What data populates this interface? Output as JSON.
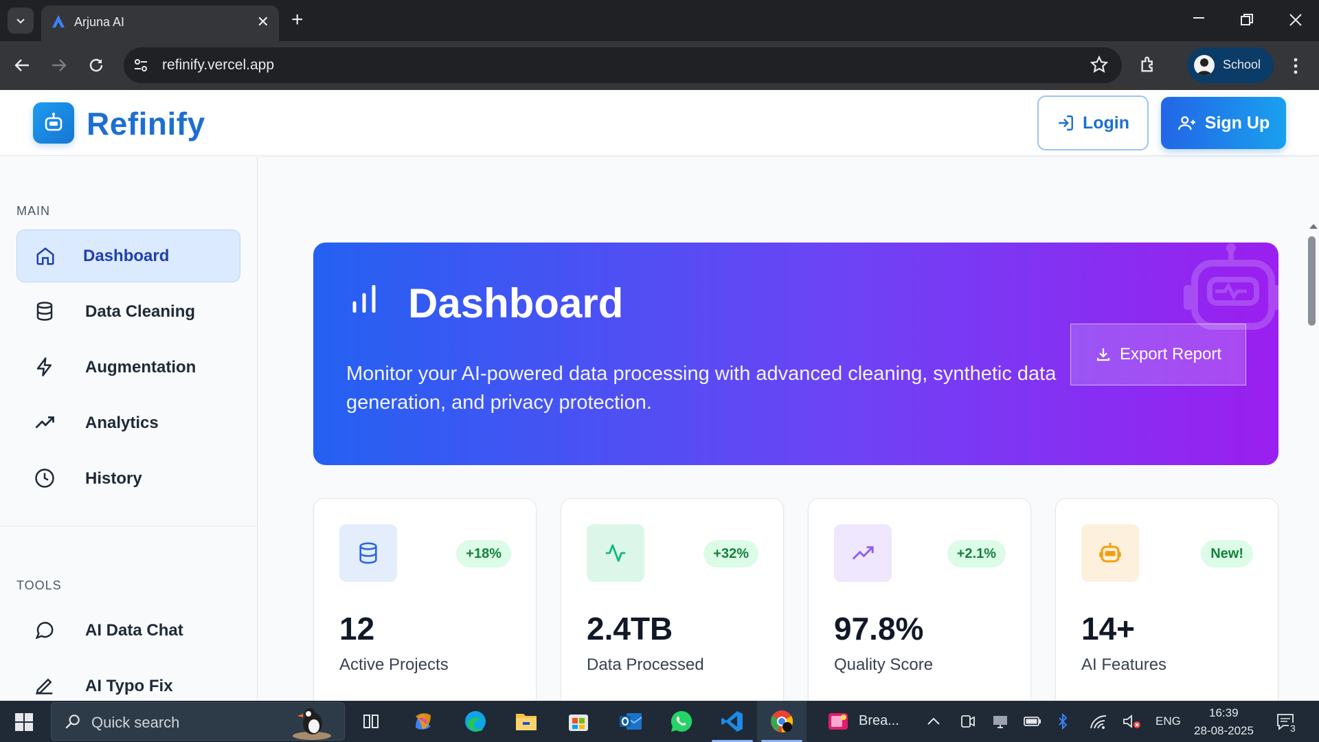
{
  "browser": {
    "tab_title": "Arjuna AI",
    "tab_close": "✕",
    "new_tab": "+",
    "url": "refinify.vercel.app",
    "profile_label": "School"
  },
  "app": {
    "brand": "Refinify",
    "login_label": "Login",
    "signup_label": "Sign Up"
  },
  "sidebar": {
    "main_title": "MAIN",
    "tools_title": "TOOLS",
    "main_items": [
      {
        "label": "Dashboard",
        "icon": "home-icon",
        "active": true
      },
      {
        "label": "Data Cleaning",
        "icon": "database-icon"
      },
      {
        "label": "Augmentation",
        "icon": "lightning-icon"
      },
      {
        "label": "Analytics",
        "icon": "trending-up-icon"
      },
      {
        "label": "History",
        "icon": "clock-icon"
      }
    ],
    "tool_items": [
      {
        "label": "AI Data Chat",
        "icon": "chat-bubble-icon"
      },
      {
        "label": "AI Typo Fix",
        "icon": "pen-icon"
      }
    ]
  },
  "hero": {
    "title": "Dashboard",
    "description": "Monitor your AI-powered data processing with advanced cleaning, synthetic data generation, and privacy protection.",
    "export_label": "Export Report"
  },
  "stats": [
    {
      "value": "12",
      "label": "Active Projects",
      "badge": "+18%",
      "icon": "database-icon",
      "icon_bg": "#e4edfc",
      "icon_color": "#2563eb"
    },
    {
      "value": "2.4TB",
      "label": "Data Processed",
      "badge": "+32%",
      "icon": "activity-icon",
      "icon_bg": "#dcf7ea",
      "icon_color": "#10b981"
    },
    {
      "value": "97.8%",
      "label": "Quality Score",
      "badge": "+2.1%",
      "icon": "trending-up-icon",
      "icon_bg": "#efe7fd",
      "icon_color": "#8b5cf6"
    },
    {
      "value": "14+",
      "label": "AI Features",
      "badge": "New!",
      "icon": "robot-icon",
      "icon_bg": "#fdf1de",
      "icon_color": "#f59e0b"
    }
  ],
  "taskbar": {
    "search_placeholder": "Quick search",
    "running_app_label": "Brea...",
    "language": "ENG",
    "time": "16:39",
    "date": "28-08-2025",
    "notification_count": "3"
  },
  "colors": {
    "brand_blue": "#1c6fd0",
    "hero_start": "#2461f2",
    "hero_end": "#9b1ff0",
    "badge_green": "#15803d"
  }
}
